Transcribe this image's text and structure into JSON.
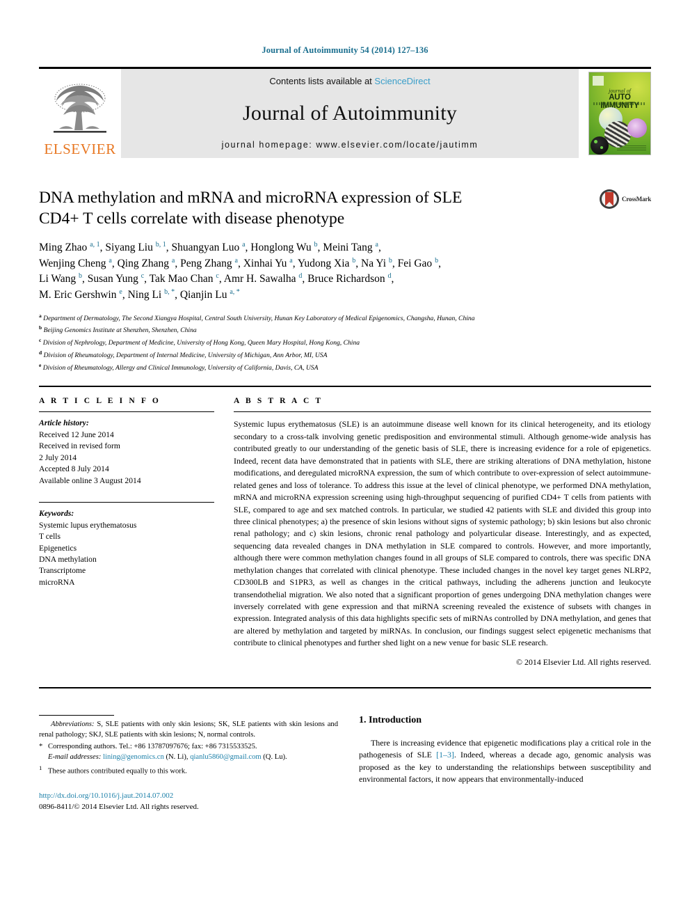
{
  "running_citation": "Journal of Autoimmunity 54 (2014) 127–136",
  "masthead": {
    "publisher_name": "ELSEVIER",
    "contents_prefix": "Contents lists available at",
    "contents_link": "ScienceDirect",
    "journal_name": "Journal of Autoimmunity",
    "homepage": "journal homepage: www.elsevier.com/locate/jautimm",
    "cover": {
      "line1": "journal of",
      "line2": "AUTO IMMUNITY"
    }
  },
  "article": {
    "title_line1": "DNA methylation and mRNA and microRNA expression of SLE",
    "title_line2": "CD4+ T cells correlate with disease phenotype",
    "crossmark_label": "CrossMark",
    "authors_line1": "Ming Zhao a, 1, Siyang Liu b, 1, Shuangyan Luo a, Honglong Wu b, Meini Tang a,",
    "authors_line2": "Wenjing Cheng a, Qing Zhang a, Peng Zhang a, Xinhai Yu a, Yudong Xia b, Na Yi b, Fei Gao b,",
    "authors_line3": "Li Wang b, Susan Yung c, Tak Mao Chan c, Amr H. Sawalha d, Bruce Richardson d,",
    "authors_line4": "M. Eric Gershwin e, Ning Li b, *, Qianjin Lu a, *",
    "affiliations": [
      {
        "mark": "a",
        "text": "Department of Dermatology, The Second Xiangya Hospital, Central South University, Hunan Key Laboratory of Medical Epigenomics, Changsha, Hunan, China"
      },
      {
        "mark": "b",
        "text": "Beijing Genomics Institute at Shenzhen, Shenzhen, China"
      },
      {
        "mark": "c",
        "text": "Division of Nephrology, Department of Medicine, University of Hong Kong, Queen Mary Hospital, Hong Kong, China"
      },
      {
        "mark": "d",
        "text": "Division of Rheumatology, Department of Internal Medicine, University of Michigan, Ann Arbor, MI, USA"
      },
      {
        "mark": "e",
        "text": "Division of Rheumatology, Allergy and Clinical Immunology, University of California, Davis, CA, USA"
      }
    ]
  },
  "article_info": {
    "heading": "A R T I C L E   I N F O",
    "history_label": "Article history:",
    "history": [
      "Received 12 June 2014",
      "Received in revised form",
      "2 July 2014",
      "Accepted 8 July 2014",
      "Available online 3 August 2014"
    ],
    "keywords_label": "Keywords:",
    "keywords": [
      "Systemic lupus erythematosus",
      "T cells",
      "Epigenetics",
      "DNA methylation",
      "Transcriptome",
      "microRNA"
    ]
  },
  "abstract": {
    "heading": "A B S T R A C T",
    "text": "Systemic lupus erythematosus (SLE) is an autoimmune disease well known for its clinical heterogeneity, and its etiology secondary to a cross-talk involving genetic predisposition and environmental stimuli. Although genome-wide analysis has contributed greatly to our understanding of the genetic basis of SLE, there is increasing evidence for a role of epigenetics. Indeed, recent data have demonstrated that in patients with SLE, there are striking alterations of DNA methylation, histone modifications, and deregulated microRNA expression, the sum of which contribute to over-expression of select autoimmune-related genes and loss of tolerance. To address this issue at the level of clinical phenotype, we performed DNA methylation, mRNA and microRNA expression screening using high-throughput sequencing of purified CD4+ T cells from patients with SLE, compared to age and sex matched controls. In particular, we studied 42 patients with SLE and divided this group into three clinical phenotypes; a) the presence of skin lesions without signs of systemic pathology; b) skin lesions but also chronic renal pathology; and c) skin lesions, chronic renal pathology and polyarticular disease. Interestingly, and as expected, sequencing data revealed changes in DNA methylation in SLE compared to controls. However, and more importantly, although there were common methylation changes found in all groups of SLE compared to controls, there was specific DNA methylation changes that correlated with clinical phenotype. These included changes in the novel key target genes NLRP2, CD300LB and S1PR3, as well as changes in the critical pathways, including the adherens junction and leukocyte transendothelial migration. We also noted that a significant proportion of genes undergoing DNA methylation changes were inversely correlated with gene expression and that miRNA screening revealed the existence of subsets with changes in expression. Integrated analysis of this data highlights specific sets of miRNAs controlled by DNA methylation, and genes that are altered by methylation and targeted by miRNAs. In conclusion, our findings suggest select epigenetic mechanisms that contribute to clinical phenotypes and further shed light on a new venue for basic SLE research.",
    "copyright": "© 2014 Elsevier Ltd. All rights reserved."
  },
  "footnotes": {
    "abbrev_label": "Abbreviations:",
    "abbrev_text": "S, SLE patients with only skin lesions; SK, SLE patients with skin lesions and renal pathology; SKJ, SLE patients with skin lesions; N, normal controls.",
    "corresponding_mark": "*",
    "corresponding_text": "Corresponding authors. Tel.: +86 13787097676; fax: +86 7315533525.",
    "email_label": "E-mail addresses:",
    "email1": "lining@genomics.cn",
    "email1_who": "(N. Li),",
    "email2": "qianlu5860@gmail.com",
    "email2_who": "(Q. Lu).",
    "equal_mark": "1",
    "equal_text": "These authors contributed equally to this work."
  },
  "publication_footer": {
    "doi": "http://dx.doi.org/10.1016/j.jaut.2014.07.002",
    "issn_line": "0896-8411/© 2014 Elsevier Ltd. All rights reserved."
  },
  "introduction": {
    "heading": "1. Introduction",
    "para_a": "There is increasing evidence that epigenetic modifications play a critical role in the pathogenesis of SLE ",
    "ref": "[1–3]",
    "para_b": ". Indeed, whereas a decade ago, genomic analysis was proposed as the key to understanding the relationships between susceptibility and environmental factors, it now appears that environmentally-induced"
  },
  "colors": {
    "link_blue": "#1b7fa8",
    "sciencedirect_blue": "#3a9ec9",
    "elsevier_orange": "#e87722",
    "crossmark_red": "#c0392b",
    "band_gray": "#e6e6e6"
  }
}
